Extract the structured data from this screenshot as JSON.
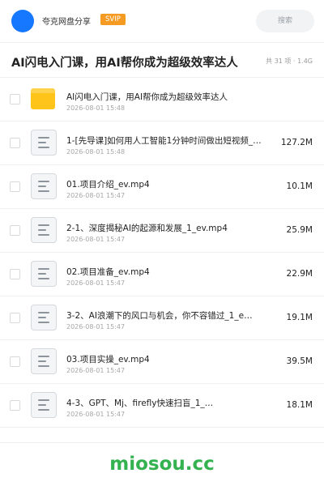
{
  "header": {
    "username": "夸克网盘分享",
    "vip_badge": "SVIP",
    "search_placeholder": "搜索"
  },
  "title": "AI闪电入门课，用AI帮你成为超级效率达人",
  "summary": "共 31 项 · 1.4G",
  "files": [
    {
      "type": "folder",
      "name": "AI闪电入门课，用AI帮你成为超级效率达人",
      "date": "2026-08-01 15:48",
      "size": ""
    },
    {
      "type": "file",
      "name": "1-[先导课]如何用人工智能1分钟时间做出短视频_…",
      "date": "2026-08-01 15:48",
      "size": "127.2M"
    },
    {
      "type": "file",
      "name": "01.项目介绍_ev.mp4",
      "date": "2026-08-01 15:47",
      "size": "10.1M"
    },
    {
      "type": "file",
      "name": "2-1、深度揭秘AI的起源和发展_1_ev.mp4",
      "date": "2026-08-01 15:47",
      "size": "25.9M"
    },
    {
      "type": "file",
      "name": "02.项目准备_ev.mp4",
      "date": "2026-08-01 15:47",
      "size": "22.9M"
    },
    {
      "type": "file",
      "name": "3-2、AI浪潮下的风口与机会，你不容错过_1_e…",
      "date": "2026-08-01 15:47",
      "size": "19.1M"
    },
    {
      "type": "file",
      "name": "03.项目实操_ev.mp4",
      "date": "2026-08-01 15:47",
      "size": "39.5M"
    },
    {
      "type": "file",
      "name": "4-3、GPT、Mj、firefly快速扫盲_1_…",
      "date": "2026-08-01 15:47",
      "size": "18.1M"
    }
  ],
  "watermark": "miosou.cc",
  "colors": {
    "accent": "#1677ff",
    "vip": "#f59a23",
    "folder": "#ffc41a",
    "watermark": "#33b24f"
  }
}
